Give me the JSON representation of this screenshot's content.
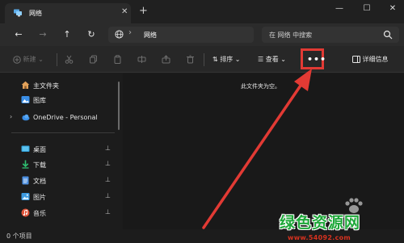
{
  "titlebar": {
    "tab_title": "网络",
    "tab_close": "✕",
    "new_tab": "+",
    "minimize": "—",
    "maximize": "☐",
    "close": "✕"
  },
  "navbar": {
    "back": "←",
    "forward": "→",
    "up": "↑",
    "refresh": "↻",
    "address_separator": "›",
    "address_text": "网络",
    "search_placeholder": "在 网络 中搜索"
  },
  "commandbar": {
    "new_label": "新建",
    "sort_label": "排序",
    "view_label": "查看",
    "more_label": "•••",
    "details_label": "详细信息"
  },
  "sidebar": {
    "items": [
      {
        "label": "主文件夹",
        "icon": "home-icon"
      },
      {
        "label": "图库",
        "icon": "gallery-icon"
      },
      {
        "label": "OneDrive - Personal",
        "icon": "cloud-icon"
      },
      {
        "label": "桌面",
        "icon": "desktop-icon",
        "pinned": true
      },
      {
        "label": "下载",
        "icon": "download-icon",
        "pinned": true
      },
      {
        "label": "文档",
        "icon": "document-icon",
        "pinned": true
      },
      {
        "label": "图片",
        "icon": "picture-icon",
        "pinned": true
      },
      {
        "label": "音乐",
        "icon": "music-icon",
        "pinned": true
      }
    ],
    "pin_glyph": "📌"
  },
  "content": {
    "empty_message": "此文件夹为空。"
  },
  "statusbar": {
    "item_count": "0 个项目"
  },
  "watermark": {
    "title": "绿色资源网",
    "url": "www.54092.com"
  },
  "colors": {
    "highlight_red": "#e23a34",
    "watermark_green": "#1fa83a",
    "window_bg": "#1c1c1c"
  }
}
